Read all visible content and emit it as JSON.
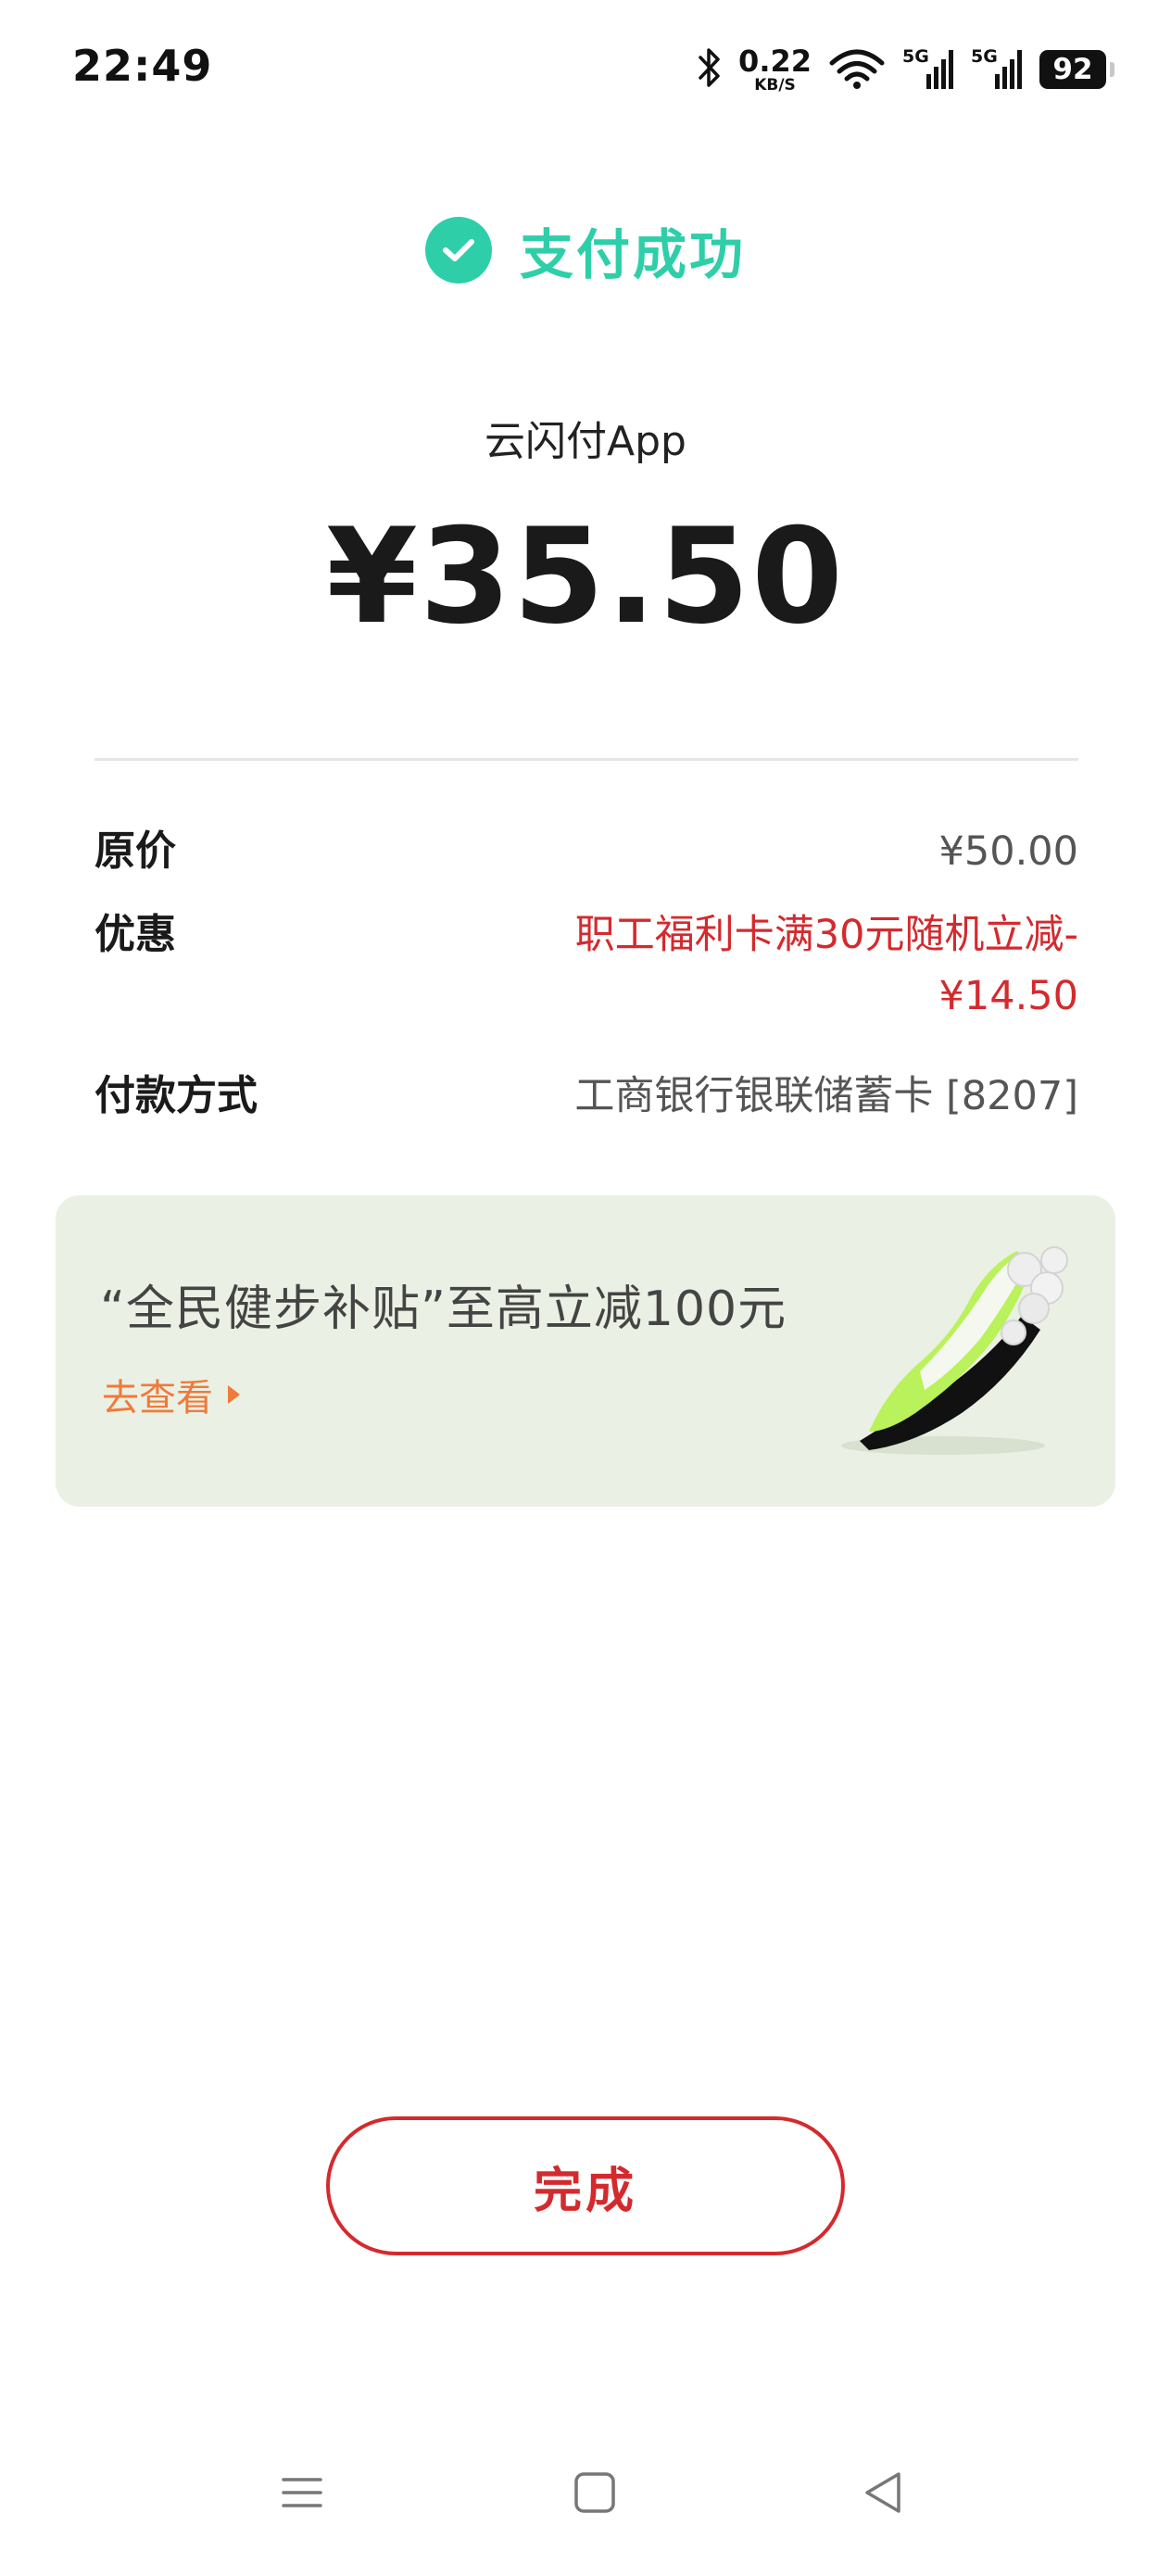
{
  "status_bar": {
    "time": "22:49",
    "net_speed_value": "0.22",
    "net_speed_unit": "KB/S",
    "signal_1_label": "5G",
    "signal_2_label": "5G",
    "battery": "92"
  },
  "header": {
    "title": "支付成功",
    "accent_color": "#2ecfa8"
  },
  "merchant": "云闪付App",
  "amount": "¥35.50",
  "details": {
    "original_label": "原价",
    "original_value": "¥50.00",
    "discount_label": "优惠",
    "discount_value": "职工福利卡满30元随机立减-¥14.50",
    "method_label": "付款方式",
    "method_value": "工商银行银联储蓄卡 [8207]"
  },
  "promo": {
    "title": "“全民健步补贴”至高立减100元",
    "link_label": "去查看",
    "image_icon": "sneaker-icon"
  },
  "done_button": "完成",
  "brand_red": "#d42a2e",
  "nav": {
    "menu_icon": "menu-icon",
    "home_icon": "home-icon",
    "back_icon": "back-icon"
  }
}
